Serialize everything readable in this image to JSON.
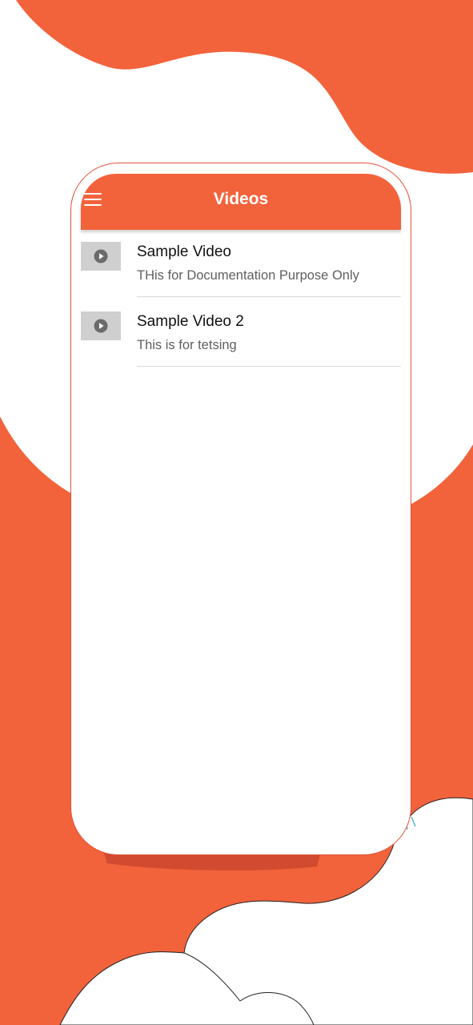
{
  "colors": {
    "accent": "#f2633b",
    "phone_border": "#e0533b",
    "thumbnail": "#cfcfcf",
    "divider": "#d9d9d9",
    "play_icon": "#6b6b6b"
  },
  "app_bar": {
    "title": "Videos",
    "menu_icon": "hamburger-menu-icon"
  },
  "videos": [
    {
      "title": "Sample Video",
      "subtitle": "THis for Documentation Purpose Only",
      "icon": "play-icon"
    },
    {
      "title": "Sample Video 2",
      "subtitle": "This is for tetsing",
      "icon": "play-icon"
    }
  ]
}
